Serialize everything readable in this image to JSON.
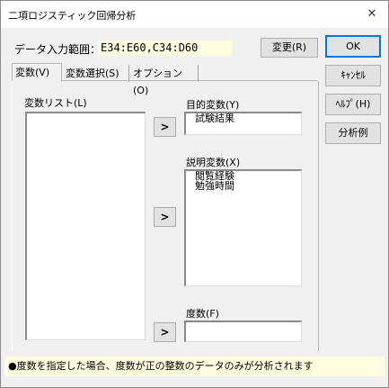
{
  "window": {
    "title": "二項ロジスティック回帰分析",
    "close_glyph": "✕"
  },
  "range": {
    "label": "データ入力範囲：",
    "value": "E34:E60,C34:D60",
    "change_button": "変更(R)"
  },
  "side_buttons": {
    "ok": "OK",
    "cancel": "ｷｬﾝｾﾙ",
    "help": "ﾍﾙﾌﾟ(H)",
    "example": "分析例"
  },
  "tabs": [
    "変数(V)",
    "変数選択(S)",
    "オプション(O)"
  ],
  "variables": {
    "list_label": "変数リスト(L)",
    "arrow": ">",
    "target_label": "目的変数(Y)",
    "target_items": [
      "試験結果"
    ],
    "explanatory_label": "説明変数(X)",
    "explanatory_items": [
      "閲覧経験",
      "勉強時間"
    ],
    "frequency_label": "度数(F)"
  },
  "note": "●度数を指定した場合、度数が正の整数のデータのみが分析されます"
}
